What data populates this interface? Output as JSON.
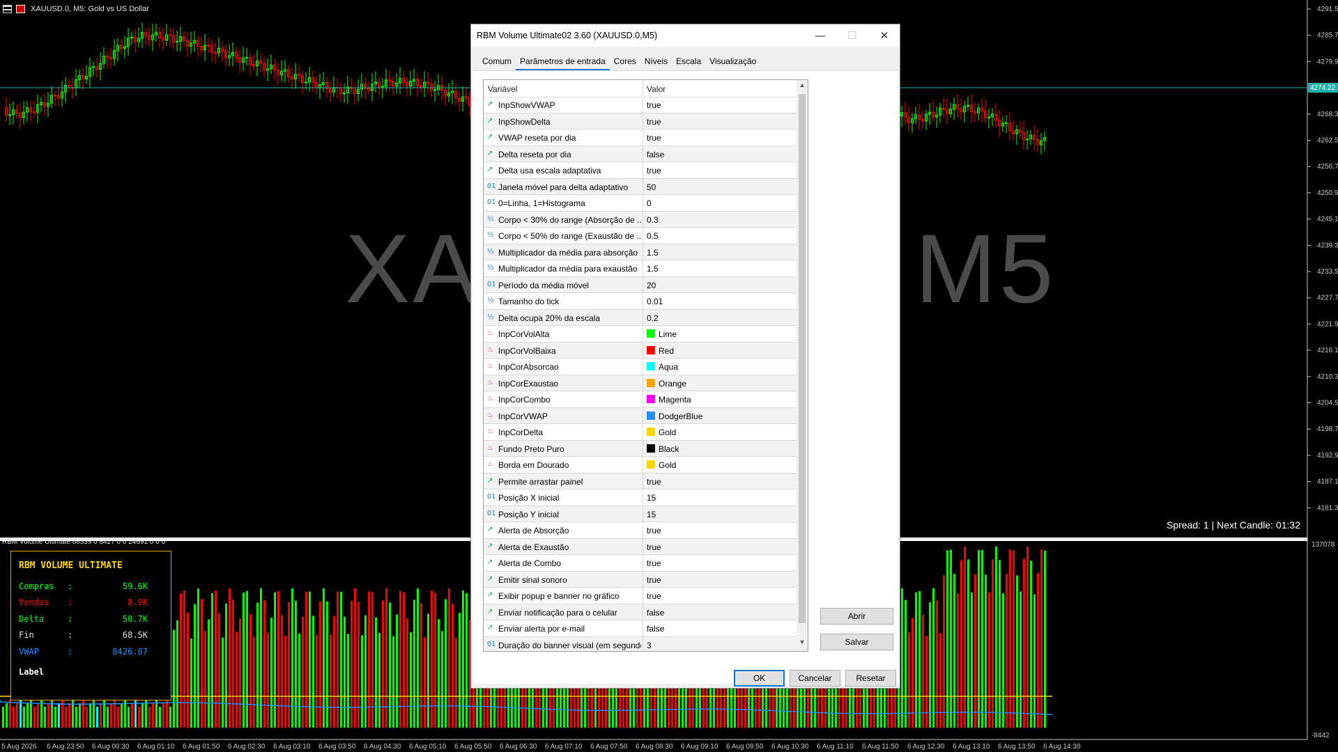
{
  "chart": {
    "title": "XAUUSD.0, M5:  Gold vs US Dollar",
    "watermark": "XAUUSD.0, M5",
    "spread": "Spread: 1 | Next Candle: 01:32",
    "current_price": "4274.22",
    "price_labels": [
      "4291.53",
      "4285.73",
      "4279.93",
      "4274.22",
      "4268.33",
      "4262.53",
      "4256.73",
      "4250.93",
      "4245.13",
      "4239.33",
      "4233.53",
      "4227.73",
      "4221.93",
      "4216.13",
      "4210.33",
      "4204.53",
      "4198.73",
      "4192.93",
      "4187.13",
      "4181.33"
    ],
    "indicator_title": "RBM Volume Ultimate 68539 0 8427 0 0 24691 0 0 0",
    "indicator_max": "137078",
    "indicator_min": "-8442",
    "time_labels": [
      "5 Aug 2026",
      "6 Aug 23:50",
      "6 Aug 00:30",
      "6 Aug 01:10",
      "6 Aug 01:50",
      "6 Aug 02:30",
      "6 Aug 03:10",
      "6 Aug 03:50",
      "6 Aug 04:30",
      "6 Aug 05:10",
      "6 Aug 05:50",
      "6 Aug 06:30",
      "6 Aug 07:10",
      "6 Aug 07:50",
      "6 Aug 08:30",
      "6 Aug 09:10",
      "6 Aug 09:50",
      "6 Aug 10:30",
      "6 Aug 11:10",
      "6 Aug 11:50",
      "6 Aug 12:30",
      "6 Aug 13:10",
      "6 Aug 13:50",
      "6 Aug 14:30"
    ],
    "colors": {
      "background": "#000000",
      "bull": "#00ff00",
      "bear": "#ff0000",
      "price_line": "#20b2aa",
      "vwap": "#1e90ff",
      "gold": "#ffd700"
    }
  },
  "panel": {
    "title": "RBM VOLUME ULTIMATE",
    "rows": [
      {
        "key": "Compras",
        "sep": ":",
        "value": "59.6K",
        "color": "#00ff00"
      },
      {
        "key": "Vendas",
        "sep": ":",
        "value": "8.9K",
        "color": "#ff0000"
      },
      {
        "key": "Delta",
        "sep": ":",
        "value": "50.7K",
        "color": "#00ff00"
      },
      {
        "key": "Fin",
        "sep": ":",
        "value": "68.5K",
        "color": "#e0e0e0"
      },
      {
        "key": "VWAP",
        "sep": ":",
        "value": "8426.87",
        "color": "#1e90ff"
      }
    ],
    "label": "Label"
  },
  "dialog": {
    "title": "RBM Volume Ultimate02 3.60 (XAUUSD.0,M5)",
    "tabs": [
      "Comum",
      "Parâmetros de entrada",
      "Cores",
      "Níveis",
      "Escala",
      "Visualização"
    ],
    "active_tab": "Parâmetros de entrada",
    "columns": {
      "variable": "Variável",
      "value": "Valor"
    },
    "params": [
      {
        "type": "bool",
        "name": "InpShowVWAP",
        "value": "true"
      },
      {
        "type": "bool",
        "name": "InpShowDelta",
        "value": "true"
      },
      {
        "type": "bool",
        "name": "VWAP reseta por dia",
        "value": "true"
      },
      {
        "type": "bool",
        "name": "Delta reseta por dia",
        "value": "false"
      },
      {
        "type": "bool",
        "name": "Delta usa escala adaptativa",
        "value": "true"
      },
      {
        "type": "int",
        "name": "Janela móvel para delta adaptativo",
        "value": "50"
      },
      {
        "type": "int",
        "name": "0=Linha, 1=Histograma",
        "value": "0"
      },
      {
        "type": "double",
        "name": "Corpo < 30% do range (Absorção de ...",
        "value": "0.3"
      },
      {
        "type": "double",
        "name": "Corpo < 50% do range (Exaustão de ...",
        "value": "0.5"
      },
      {
        "type": "double",
        "name": "Multiplicador da média para absorção",
        "value": "1.5"
      },
      {
        "type": "double",
        "name": "Multiplicador da média para exaustão",
        "value": "1.5"
      },
      {
        "type": "int",
        "name": "Período da média móvel",
        "value": "20"
      },
      {
        "type": "double",
        "name": "Tamanho do tick",
        "value": "0.01"
      },
      {
        "type": "double",
        "name": "Delta ocupa 20% da escala",
        "value": "0.2"
      },
      {
        "type": "color",
        "name": "InpCorVolAlta",
        "value": "Lime",
        "swatch": "#00ff00"
      },
      {
        "type": "color",
        "name": "InpCorVolBaixa",
        "value": "Red",
        "swatch": "#ff0000"
      },
      {
        "type": "color",
        "name": "InpCorAbsorcao",
        "value": "Aqua",
        "swatch": "#00ffff"
      },
      {
        "type": "color",
        "name": "InpCorExaustao",
        "value": "Orange",
        "swatch": "#ffa500"
      },
      {
        "type": "color",
        "name": "InpCorCombo",
        "value": "Magenta",
        "swatch": "#ff00ff"
      },
      {
        "type": "color",
        "name": "InpCorVWAP",
        "value": "DodgerBlue",
        "swatch": "#1e90ff"
      },
      {
        "type": "color",
        "name": "InpCorDelta",
        "value": "Gold",
        "swatch": "#ffd700"
      },
      {
        "type": "color",
        "name": "Fundo Preto Puro",
        "value": "Black",
        "swatch": "#000000"
      },
      {
        "type": "color",
        "name": "Borda em Dourado",
        "value": "Gold",
        "swatch": "#ffd700"
      },
      {
        "type": "bool",
        "name": "Permite arrastar painel",
        "value": "true"
      },
      {
        "type": "int",
        "name": "Posição X inicial",
        "value": "15"
      },
      {
        "type": "int",
        "name": "Posição Y inicial",
        "value": "15"
      },
      {
        "type": "bool",
        "name": "Alerta de Absorção",
        "value": "true"
      },
      {
        "type": "bool",
        "name": "Alerta de Exaustão",
        "value": "true"
      },
      {
        "type": "bool",
        "name": "Alerta de Combo",
        "value": "true"
      },
      {
        "type": "bool",
        "name": "Emitir sinal sonoro",
        "value": "true"
      },
      {
        "type": "bool",
        "name": "Exibir popup e banner no gráfico",
        "value": "true"
      },
      {
        "type": "bool",
        "name": "Enviar notificação para o celular",
        "value": "false"
      },
      {
        "type": "bool",
        "name": "Enviar alerta por e-mail",
        "value": "false"
      },
      {
        "type": "int",
        "name": "Duração do banner visual (em segundos)",
        "value": "3"
      }
    ],
    "buttons": {
      "abrir": "Abrir",
      "salvar": "Salvar",
      "ok": "OK",
      "cancelar": "Cancelar",
      "resetar": "Resetar"
    }
  }
}
